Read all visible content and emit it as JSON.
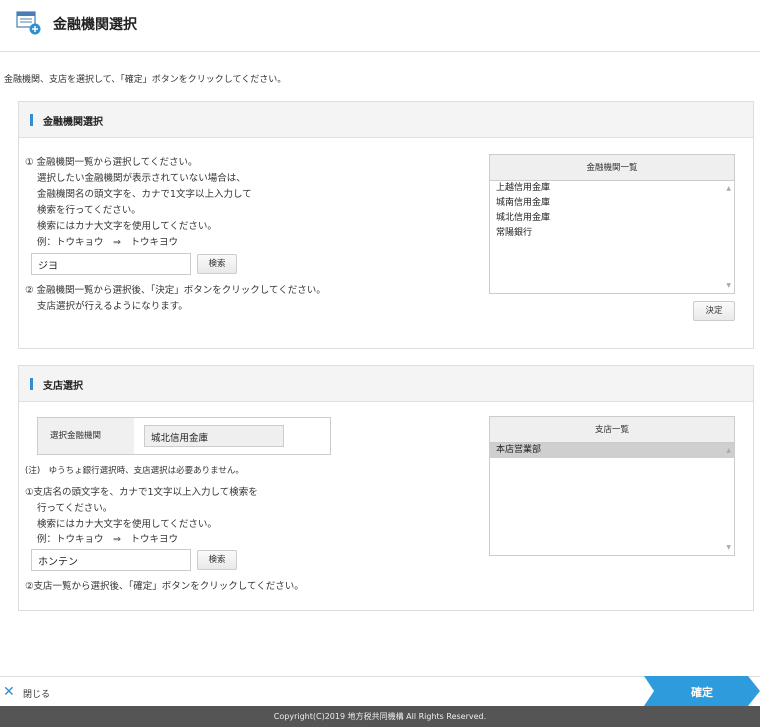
{
  "header": {
    "title": "金融機関選択",
    "logo_icon": "bank-document-plus-icon"
  },
  "intro": "金融機関、支店を選択して、「確定」ボタンをクリックしてください。",
  "bank_panel": {
    "title": "金融機関選択",
    "instructions": [
      "① 金融機関一覧から選択してください。",
      "選択したい金融機関が表示されていない場合は、",
      "金融機関名の頭文字を、カナで1文字以上入力して",
      "検索を行ってください。",
      "検索にはカナ大文字を使用してください。",
      "例：トウキョウ　⇒　トウキヨウ"
    ],
    "search_value": "ジヨ",
    "search_button": "検索",
    "instructions2": [
      "② 金融機関一覧から選択後、「決定」ボタンをクリックしてください。",
      "支店選択が行えるようになります。"
    ],
    "list_header": "金融機関一覧",
    "list_items": [
      "上越信用金庫",
      "城南信用金庫",
      "城北信用金庫",
      "常陽銀行"
    ],
    "decide_button": "決定"
  },
  "branch_panel": {
    "title": "支店選択",
    "selected_label": "選択金融機関",
    "selected_value": "城北信用金庫",
    "note": "(注)　ゆうちょ銀行選択時、支店選択は必要ありません。",
    "instructions": [
      "①支店名の頭文字を、カナで1文字以上入力して検索を",
      "行ってください。",
      "検索にはカナ大文字を使用してください。",
      "例：トウキョウ　⇒　トウキヨウ"
    ],
    "search_value": "ホンテン",
    "search_button": "検索",
    "instructions2": "②支店一覧から選択後、「確定」ボタンをクリックしてください。",
    "list_header": "支店一覧",
    "list_items": [
      "本店営業部"
    ]
  },
  "footer": {
    "close_label": "閉じる",
    "confirm_label": "確定",
    "copyright": "Copyright(C)2019 地方税共同機構 All Rights Reserved."
  },
  "colors": {
    "accent": "#2f8fd0",
    "confirm": "#2e9bdc",
    "footer_bg": "#555555"
  }
}
